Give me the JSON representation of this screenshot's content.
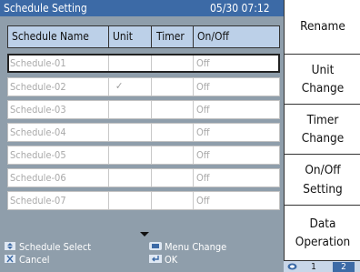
{
  "title": "Schedule Setting",
  "datetime": "05/30 07:12",
  "columns": [
    "Schedule Name",
    "Unit",
    "Timer",
    "On/Off"
  ],
  "rows": [
    {
      "name": "Schedule-01",
      "unit_checked": false,
      "onoff": "Off",
      "selected": true
    },
    {
      "name": "Schedule-02",
      "unit_checked": true,
      "unit_mark": "✓",
      "onoff": "Off",
      "selected": false
    },
    {
      "name": "Schedule-03",
      "unit_checked": false,
      "onoff": "Off",
      "selected": false
    },
    {
      "name": "Schedule-04",
      "unit_checked": false,
      "onoff": "Off",
      "selected": false
    },
    {
      "name": "Schedule-05",
      "unit_checked": false,
      "onoff": "Off",
      "selected": false
    },
    {
      "name": "Schedule-06",
      "unit_checked": false,
      "onoff": "Off",
      "selected": false
    },
    {
      "name": "Schedule-07",
      "unit_checked": false,
      "onoff": "Off",
      "selected": false
    }
  ],
  "footer": {
    "schedule_select": "Schedule Select",
    "cancel": "Cancel",
    "menu_change": "Menu Change",
    "ok": "OK"
  },
  "side_buttons": [
    {
      "line1": "Rename",
      "line2": ""
    },
    {
      "line1": "Unit",
      "line2": "Change"
    },
    {
      "line1": "Timer",
      "line2": "Change"
    },
    {
      "line1": "On/Off",
      "line2": "Setting"
    },
    {
      "line1": "Data",
      "line2": "Operation"
    }
  ],
  "pages": [
    "1",
    "2"
  ],
  "current_page": "2",
  "colors": {
    "panel": "#8f9eab",
    "titlebar": "#3c6aa6",
    "header": "#bcd0e8"
  },
  "icons": [
    "updown-icon",
    "cancel-icon",
    "menu-change-icon",
    "enter-icon",
    "page-toggle-icon"
  ]
}
